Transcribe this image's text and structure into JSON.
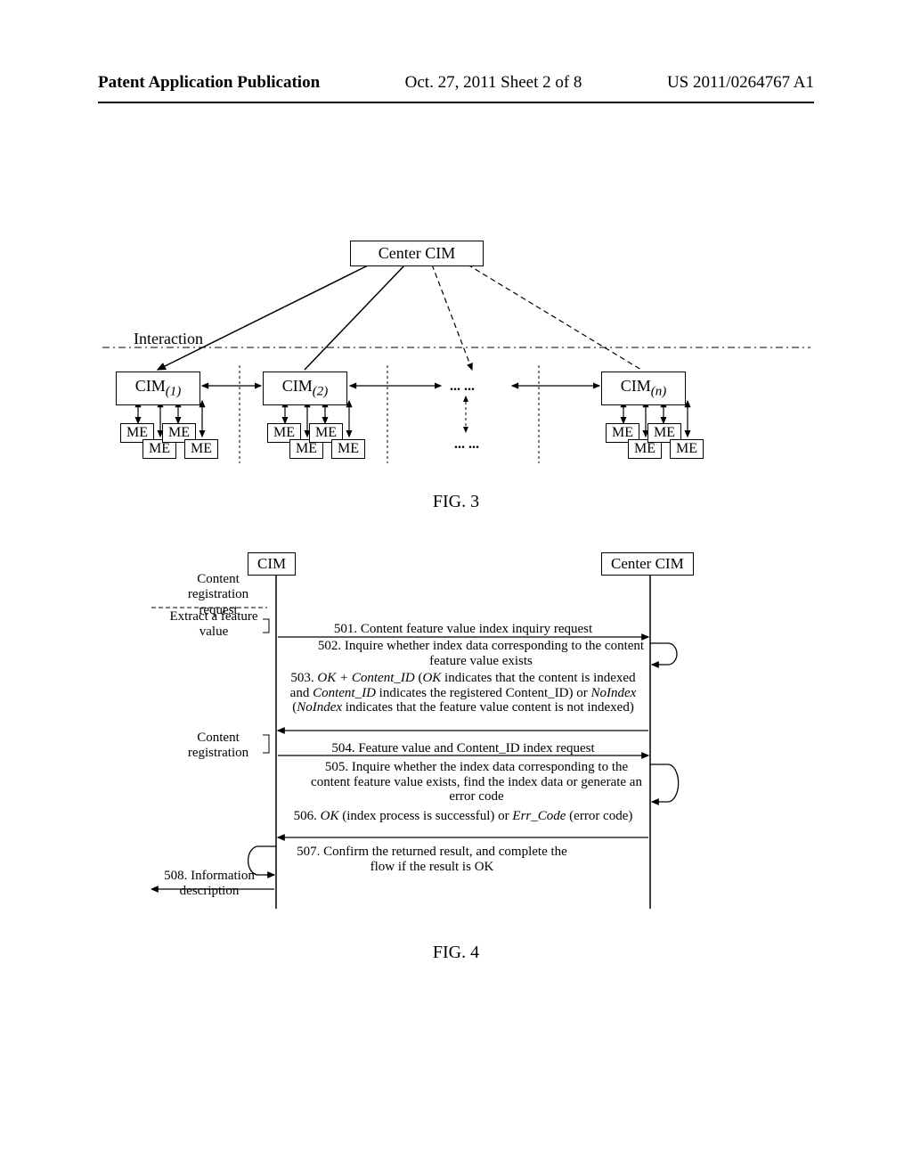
{
  "header": {
    "left": "Patent Application Publication",
    "center": "Oct. 27, 2011  Sheet 2 of 8",
    "right": "US 2011/0264767 A1"
  },
  "fig3": {
    "center_cim": "Center CIM",
    "interaction": "Interaction",
    "cim1": "CIM",
    "cim1_sub": "(1)",
    "cim2": "CIM",
    "cim2_sub": "(2)",
    "cimn": "CIM",
    "cimn_sub": "(n)",
    "me": "ME",
    "dots": "...   ...",
    "caption": "FIG. 3"
  },
  "fig4": {
    "cim": "CIM",
    "center_cim": "Center CIM",
    "side1a": "Content registration request",
    "side1b": "Extract a feature value",
    "side2": "Content registration",
    "side3": "508. Information description",
    "step501": "501. Content feature value index inquiry request",
    "step502": "502. Inquire whether index data corresponding to the content feature value exists",
    "step503_a": "503. ",
    "step503_b": "OK + Content_ID",
    "step503_c": " (",
    "step503_d": "OK",
    "step503_e": " indicates that the content is indexed and ",
    "step503_f": "Content_ID",
    "step503_g": " indicates the registered Content_ID) or ",
    "step503_h": "NoIndex",
    "step503_i": " (",
    "step503_j": "NoIndex",
    "step503_k": " indicates that the feature value content is not indexed)",
    "step504": "504. Feature value and Content_ID index request",
    "step505": "505. Inquire whether the index data corresponding to the content feature value exists, find the index data or generate an error code",
    "step506_a": "506. ",
    "step506_b": "OK",
    "step506_c": " (index process is successful) or ",
    "step506_d": "Err_Code",
    "step506_e": " (error code)",
    "step507": "507. Confirm the returned result, and complete the flow if the result is OK",
    "caption": "FIG. 4"
  }
}
